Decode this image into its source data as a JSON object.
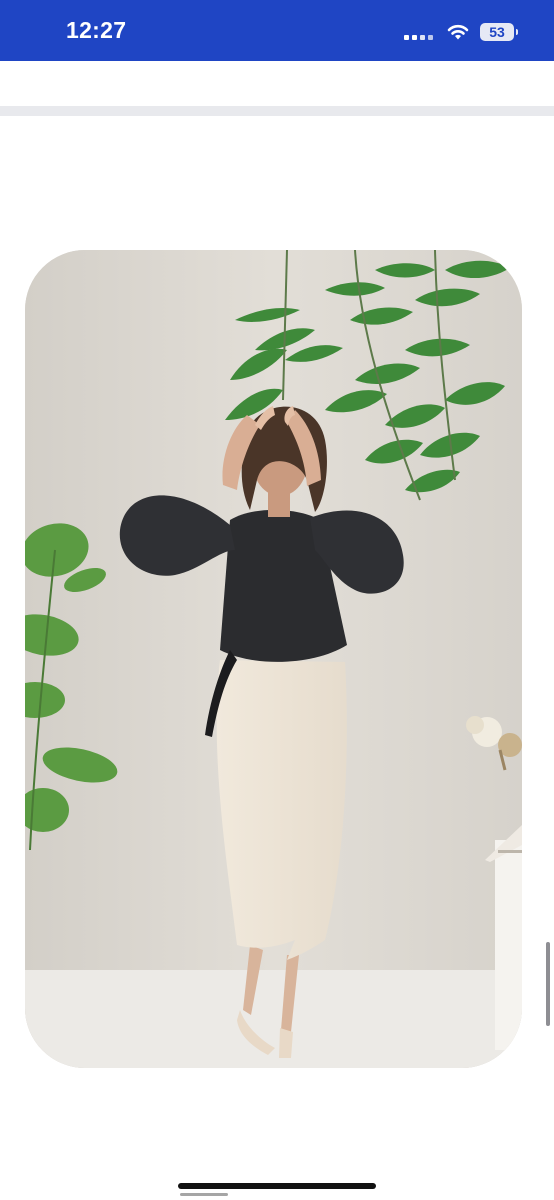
{
  "status_bar": {
    "time": "12:27",
    "battery_level": "53",
    "signal_icon": "cellular-signal-icon",
    "wifi_icon": "wifi-icon",
    "battery_icon": "battery-icon",
    "color": "#1f45c4"
  },
  "media": {
    "type": "video",
    "subject": "woman-posing-black-blouse-cream-skirt"
  }
}
